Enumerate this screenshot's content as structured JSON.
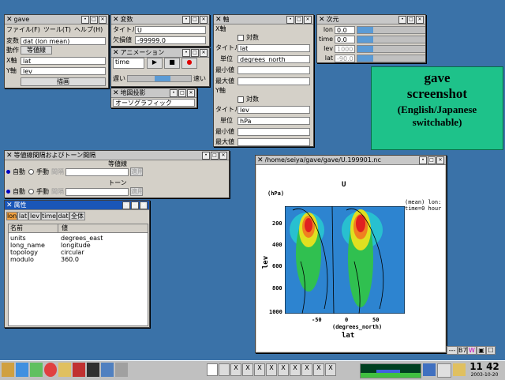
{
  "gave": {
    "title": "gave",
    "menu": [
      "ファイル(F)",
      "ツール(T)",
      "ヘルプ(H)"
    ],
    "var_label": "変数",
    "var_value": "dat (lon mean)",
    "action_label": "動作",
    "action_value": "等値線",
    "x_label": "X軸",
    "x_value": "lat",
    "y_label": "Y軸",
    "y_value": "lev",
    "draw": "描画"
  },
  "vars": {
    "title": "変数",
    "title_label": "タイトル",
    "title_value": "U",
    "missing_label": "欠損値",
    "missing_value": "-99999.0"
  },
  "anim": {
    "title": "アニメーション",
    "dim": "time",
    "slow": "遅い",
    "fast": "速い"
  },
  "proj": {
    "title": "地図投影",
    "value": "オーソグラフィック"
  },
  "axis": {
    "title": "軸",
    "x_sec": "X軸",
    "log": "対数",
    "title_label": "タイトル",
    "x_title": "lat",
    "unit_label": "単位",
    "x_unit": "degrees_north",
    "min_label": "最小値",
    "max_label": "最大値",
    "y_sec": "Y軸",
    "y_title": "lev",
    "y_unit": "hPa"
  },
  "dims": {
    "title": "次元",
    "rows": [
      {
        "name": "lon",
        "value": "0.0"
      },
      {
        "name": "time",
        "value": "0.0"
      },
      {
        "name": "lev",
        "value": "1000.0"
      },
      {
        "name": "lat",
        "value": "-90.0"
      }
    ]
  },
  "banner": {
    "line1": "gave",
    "line2": "screenshot",
    "line3": "(English/Japanese",
    "line4": "switchable)"
  },
  "contour": {
    "title": "等値線間隔およびトーン間隔",
    "sec1": "等値線",
    "sec2": "トーン",
    "auto": "自動",
    "manual": "手動",
    "interval": "間隔",
    "apply": "適用"
  },
  "attr": {
    "title": "属性",
    "tabs": [
      "lon",
      "lat",
      "lev",
      "time",
      "dat",
      "全体"
    ],
    "col_name": "名前",
    "col_value": "値",
    "rows": [
      {
        "name": "units",
        "value": "degrees_east"
      },
      {
        "name": "long_name",
        "value": "longitude"
      },
      {
        "name": "topology",
        "value": "circular"
      },
      {
        "name": "modulo",
        "value": "360.0"
      }
    ]
  },
  "plot": {
    "title": "/home/seiya/gave/gave/U.199901.nc",
    "var": "U",
    "yunit": "(hPa)",
    "info1": "(mean) lon:",
    "info2": "time=0 hour",
    "ylabel": "lev",
    "xlabel": "lat",
    "xunit": "(degrees_north)",
    "yticks": [
      "200",
      "400",
      "600",
      "800",
      "1000"
    ],
    "xticks": [
      "-50",
      "0",
      "50"
    ]
  },
  "tray": {
    "date": "2003-10-20",
    "time": "11 42"
  },
  "colors": {
    "desktop": "#3a72a8",
    "banner": "#1ec28a"
  }
}
